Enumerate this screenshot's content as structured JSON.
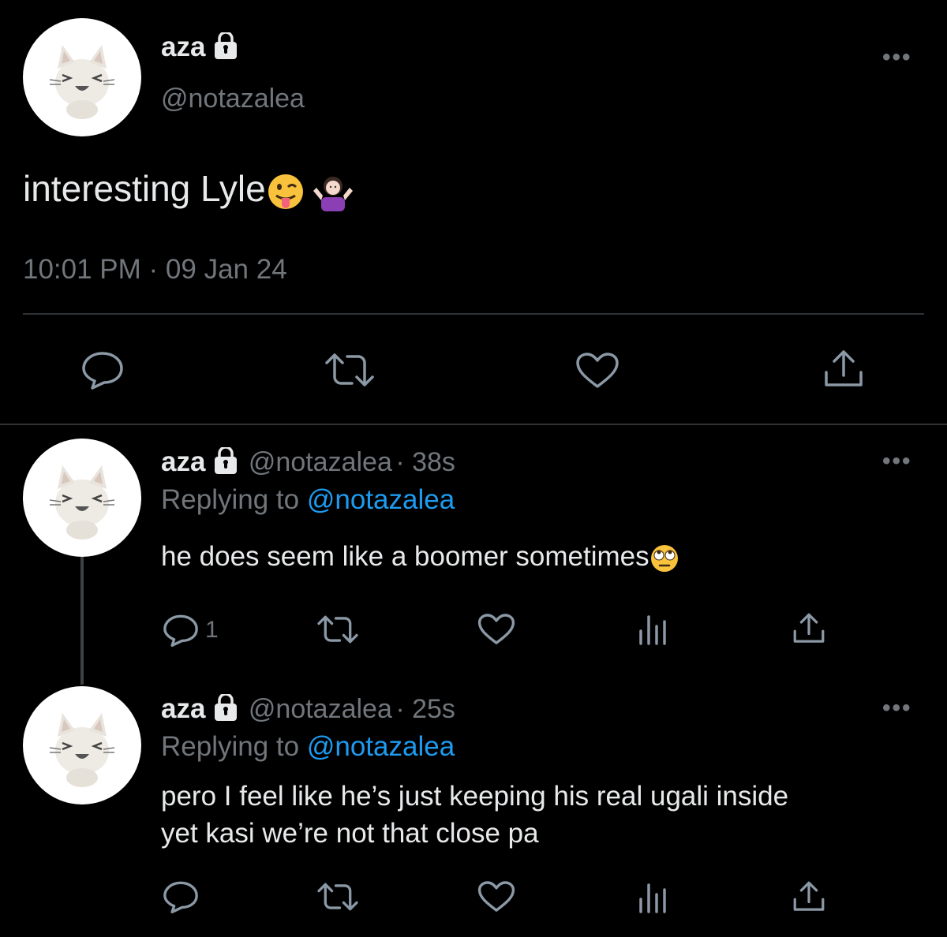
{
  "main_tweet": {
    "author_name": "aza",
    "author_handle": "@notazalea",
    "text": "interesting Lyle",
    "timestamp": "10:01 PM · 09 Jan 24",
    "more_label": "•••",
    "avatar_icon": "plush-cat-avatar",
    "emojis": [
      "tongue-out-face",
      "shrugging-woman"
    ]
  },
  "replies": [
    {
      "author_name": "aza",
      "author_handle": "@notazalea",
      "time": "· 38s",
      "replying_label": "Replying to",
      "replying_to": "@notazalea",
      "text": "he does seem like a boomer sometimes",
      "emoji": "eye-roll-face",
      "reply_count": "1",
      "more_label": "•••"
    },
    {
      "author_name": "aza",
      "author_handle": "@notazalea",
      "time": "· 25s",
      "replying_label": "Replying to",
      "replying_to": "@notazalea",
      "text_line1": "pero I feel like he’s just keeping his real ugali inside",
      "text_line2": "yet kasi we’re not that close pa",
      "reply_count": "",
      "more_label": "•••"
    }
  ],
  "colors": {
    "background": "#000000",
    "text": "#e7e9ea",
    "muted": "#71767b",
    "link": "#1d9bf0",
    "divider": "#2f3336"
  }
}
